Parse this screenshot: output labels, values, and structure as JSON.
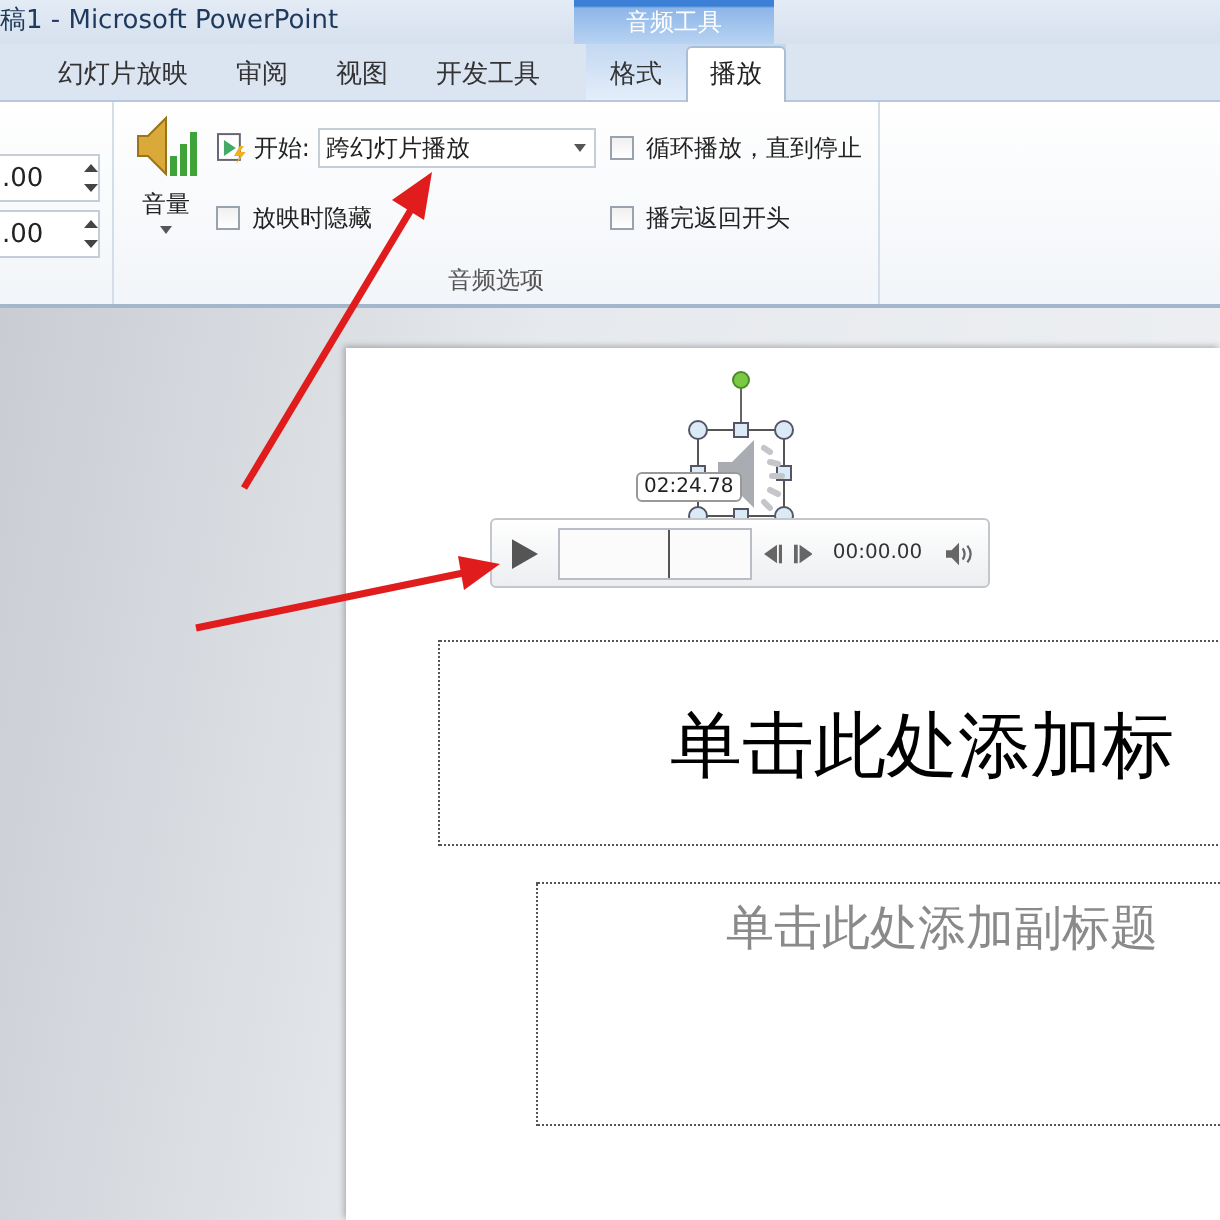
{
  "window": {
    "title": "稿1 - Microsoft PowerPoint",
    "context_header": "音频工具"
  },
  "tabs": [
    {
      "label": "幻灯片放映",
      "selected": false,
      "kind": "normal"
    },
    {
      "label": "审阅",
      "selected": false,
      "kind": "normal"
    },
    {
      "label": "视图",
      "selected": false,
      "kind": "normal"
    },
    {
      "label": "开发工具",
      "selected": false,
      "kind": "normal"
    },
    {
      "label": "格式",
      "selected": false,
      "kind": "contextual"
    },
    {
      "label": "播放",
      "selected": true,
      "kind": "contextual"
    }
  ],
  "ribbon": {
    "timing_fields": [
      {
        "value": ".00"
      },
      {
        "value": ".00"
      }
    ],
    "audio_options": {
      "volume_label": "音量",
      "start_label": "开始:",
      "start_value": "跨幻灯片播放",
      "group_label": "音频选项",
      "checkboxes": [
        {
          "label": "循环播放，直到停止",
          "checked": false
        },
        {
          "label": "放映时隐藏",
          "checked": false
        },
        {
          "label": "播完返回开头",
          "checked": false
        }
      ]
    }
  },
  "player": {
    "time_tooltip": "02:24.78",
    "position": "00:00.00",
    "level": 0.57
  },
  "slide": {
    "title_placeholder": "单击此处添加标",
    "subtitle_placeholder": "单击此处添加副标题"
  }
}
